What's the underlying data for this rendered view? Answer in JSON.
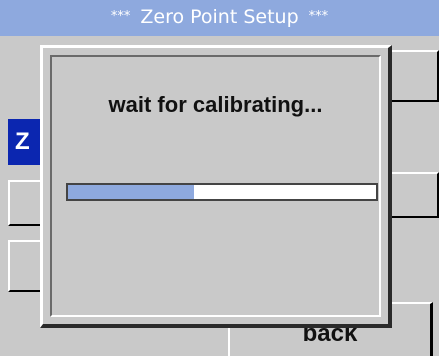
{
  "header": {
    "stars_left": "***",
    "title": "Zero Point Setup",
    "stars_right": "***"
  },
  "background": {
    "selected_peek": "Z",
    "back_label": "back"
  },
  "dialog": {
    "message": "wait for calibrating...",
    "progress": 0.41
  },
  "colors": {
    "title_bar": "#8ea9de",
    "selected": "#0b26b0",
    "panel": "#c9c9c9",
    "progress_fill": "#8ea9de"
  }
}
